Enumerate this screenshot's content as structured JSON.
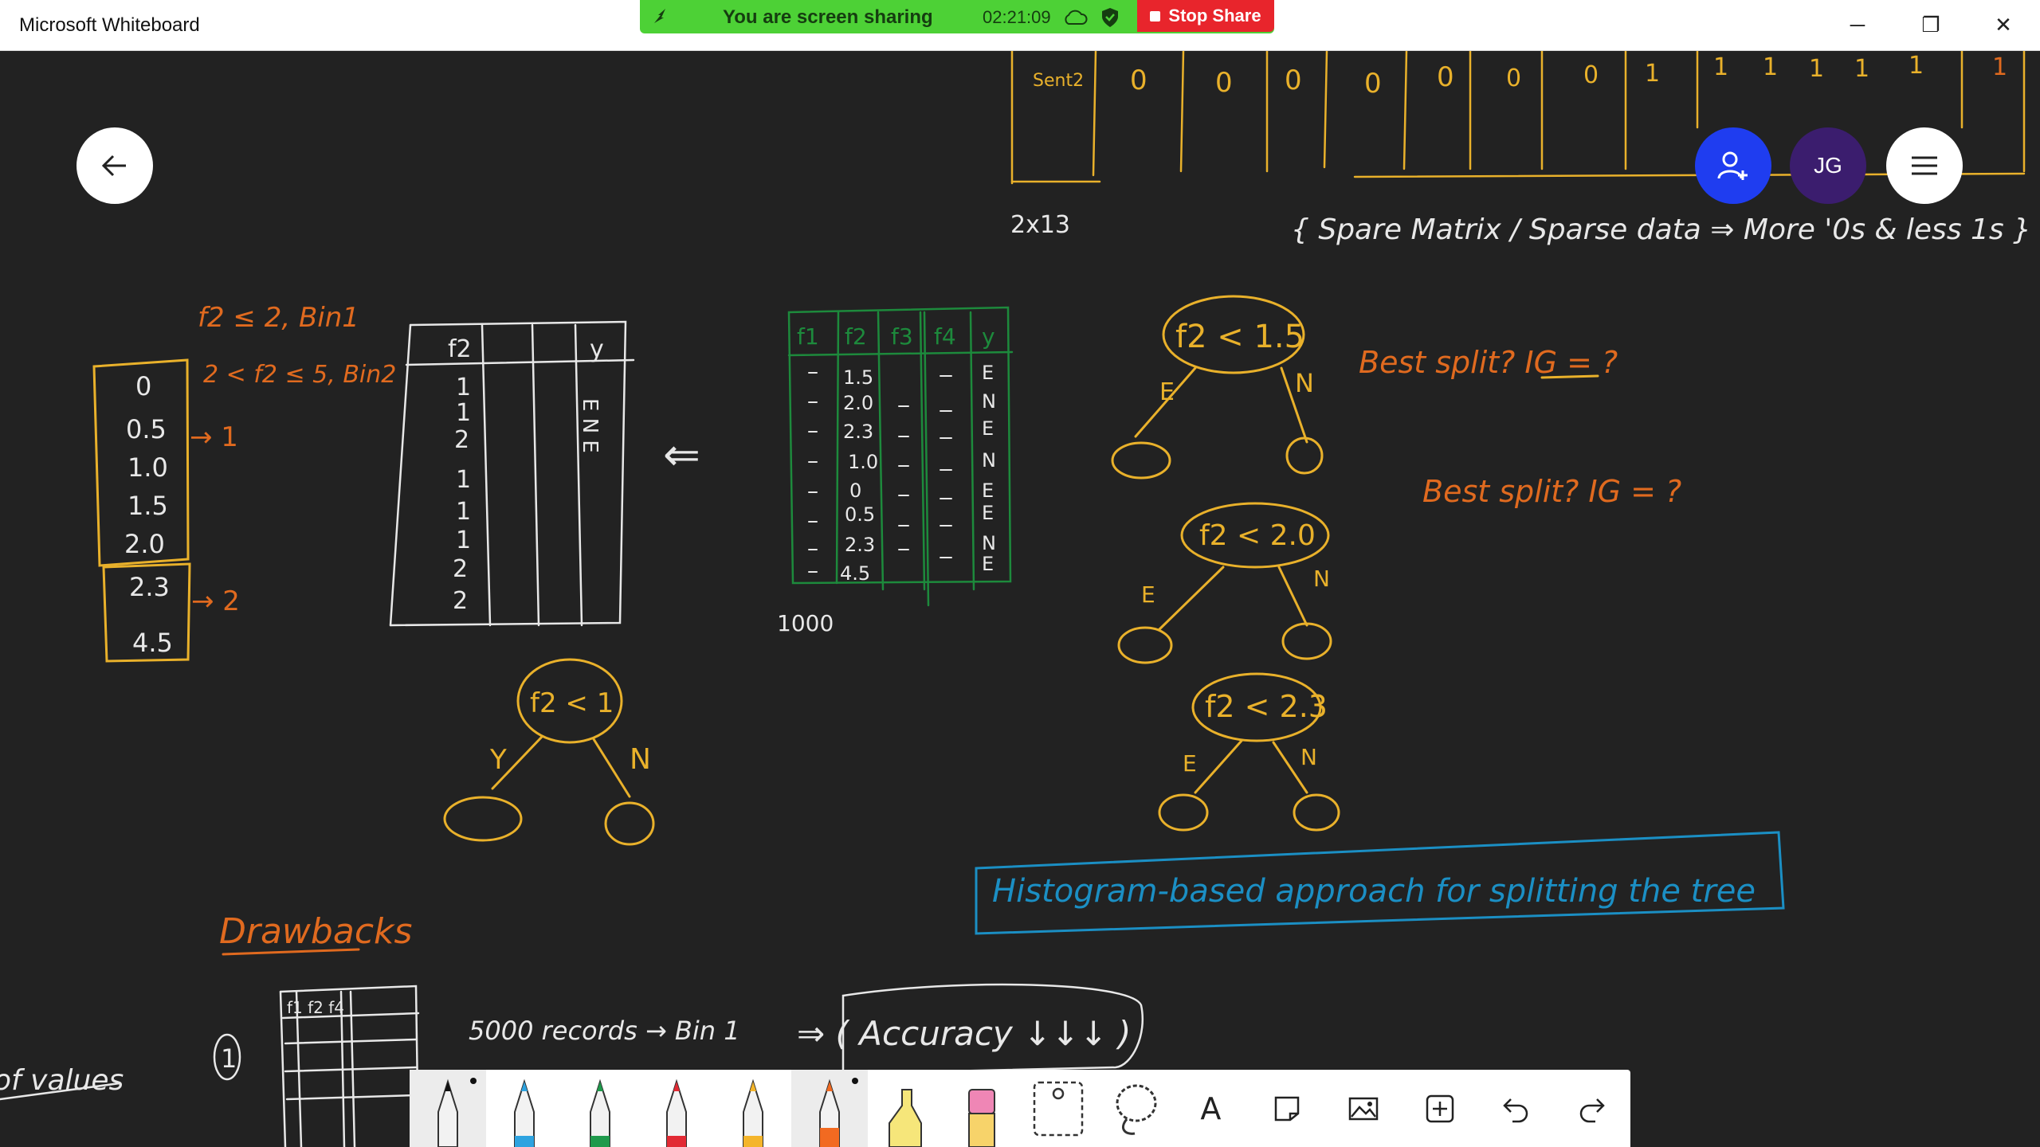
{
  "window": {
    "title": "Microsoft Whiteboard",
    "minimize_glyph": "─",
    "restore_glyph": "❐",
    "close_glyph": "✕"
  },
  "share_bar": {
    "status": "You are screen sharing",
    "timer": "02:21:09",
    "stop_label": "Stop Share",
    "color": "#4dd136"
  },
  "header": {
    "avatar_initials": "JG",
    "invite_color": "#1f3df0",
    "avatar_color": "#3b1d6e"
  },
  "ink": {
    "top_matrix_row_label": "Sent2",
    "top_matrix_values": [
      "0",
      "0",
      "0",
      "0",
      "0",
      "0",
      "0",
      "1",
      "1",
      "1",
      "1",
      "1",
      "1",
      "1"
    ],
    "matrix_size": "2x13",
    "sparse_note": "{ Spare Matrix / Sparse data ⇒ More '0s & less 1s }",
    "bin_rule_1": "f2 ≤ 2, Bin1",
    "bin_rule_2": "2 < f2 ≤ 5, Bin2",
    "bin_values_1": [
      "0",
      "0.5",
      "1.0",
      "1.5",
      "2.0"
    ],
    "bin_values_2": [
      "2.3",
      "4.5"
    ],
    "bin_arrow_1": "→ 1",
    "bin_arrow_2": "→ 2",
    "binned_table_header_f": "f2",
    "binned_table_header_y": "y",
    "binned_table_f_values": [
      "1",
      "1",
      "2",
      "1",
      "1",
      "1",
      "2",
      "2"
    ],
    "binned_table_y_values": "E N E",
    "implies_arrow": "⇐",
    "green_table_headers": [
      "f1",
      "f2",
      "f3",
      "f4",
      "y"
    ],
    "green_table_f2": [
      "1.5",
      "2.0",
      "2.3",
      "1.0",
      "0",
      "0.5",
      "2.3",
      "4.5"
    ],
    "green_table_y": [
      "E",
      "N",
      "E",
      "N",
      "E",
      "E",
      "N",
      "E"
    ],
    "green_table_count": "1000",
    "split_left_label": "f2 < 1",
    "split_left_yes": "Y",
    "split_left_no": "N",
    "split_1_label": "f2 < 1.5",
    "split_2_label": "f2 < 2.0",
    "split_3_label": "f2 < 2.3",
    "split_e": "E",
    "split_n": "N",
    "best_split_1": "Best split? IG = ?",
    "best_split_2": "Best split? IG = ?",
    "histogram_note": "Histogram-based approach for splitting the tree",
    "drawbacks_title": "Drawbacks",
    "drawback_index": "1",
    "mini_table_headers": "f1 f2 f4",
    "records_note": "5000 records → Bin 1",
    "accuracy_note": "⇒ ( Accuracy ↓↓↓ )",
    "left_edge_note": "of values",
    "colors": {
      "orange": "#e06a1f",
      "yellow": "#e9b12b",
      "white": "#e8e8e8",
      "green": "#1d8a3c",
      "blue": "#1b8fc4"
    }
  },
  "toolbar": {
    "tools": [
      {
        "name": "pen-black",
        "color": "#111111"
      },
      {
        "name": "pen-blue",
        "color": "#2ea3e0"
      },
      {
        "name": "pen-green",
        "color": "#1f9a4c"
      },
      {
        "name": "pen-red",
        "color": "#e22a34"
      },
      {
        "name": "pen-yellow",
        "color": "#f4b52b"
      },
      {
        "name": "pen-orange",
        "color": "#f26a21"
      },
      {
        "name": "highlighter",
        "color": "#f6e67a"
      },
      {
        "name": "eraser",
        "color": "#ef86b5"
      }
    ],
    "text_tool_label": "A"
  }
}
